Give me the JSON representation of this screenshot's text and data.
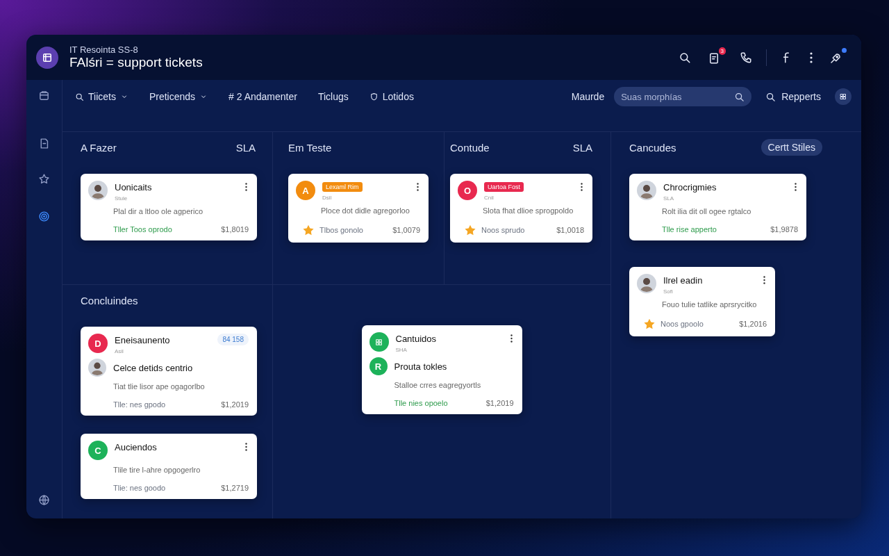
{
  "header": {
    "subtitle": "IT Resointa SS-8",
    "title": "FAlśri = support tickets",
    "notification_count": "3"
  },
  "sidebar": {
    "items": [
      {
        "selected": false
      },
      {
        "selected": false
      },
      {
        "selected": false
      },
      {
        "selected": true
      },
      {
        "selected": false
      }
    ]
  },
  "nav": {
    "tabs": [
      {
        "label": "Tiicets",
        "kind": "search",
        "dropdown": true
      },
      {
        "label": "Preticends",
        "kind": "plain",
        "dropdown": true
      },
      {
        "label": "# 2 Andamenter",
        "kind": "plain",
        "dropdown": false
      },
      {
        "label": "Ticlugs",
        "kind": "plain",
        "dropdown": false
      },
      {
        "label": "Lotidos",
        "kind": "shield",
        "dropdown": false
      }
    ],
    "filter_label": "Maurde",
    "search": {
      "placeholder": "Suas morphías"
    },
    "reports": "Repperts"
  },
  "lanes": [
    {
      "heading": "A Fazer",
      "aside": {
        "text": "SLA",
        "kind": "label"
      },
      "cards": [
        {
          "avatar": {
            "kind": "photo"
          },
          "title": "Uonicaits",
          "subtitle": "Stule",
          "desc": "Plal dir a ltloo ole agperico",
          "star": false,
          "footer": {
            "text": "Tller Toos oprodo",
            "kind": "success"
          },
          "amount": "$1,8019",
          "menu": true
        }
      ]
    },
    {
      "heading": "Em Teste",
      "cards": [
        {
          "avatar": {
            "kind": "letter",
            "letter": "A",
            "color": "#f28c0f"
          },
          "tag": {
            "text": "Lexaml Rim",
            "color": "#f28c0f"
          },
          "subtitle": "Dsil",
          "desc": "Ploce dot didle agregorloo",
          "star": true,
          "footer": {
            "text": "Tlbos gonolo",
            "kind": "muted"
          },
          "amount": "$1,0079",
          "menu": true
        }
      ]
    },
    {
      "heading": "Contude",
      "aside": {
        "text": "SLA",
        "kind": "label"
      },
      "cards": [
        {
          "avatar": {
            "kind": "letter",
            "letter": "O",
            "color": "#e8294f"
          },
          "tag": {
            "text": "Uartoa Fost",
            "color": "#e8294f"
          },
          "subtitle": "Cnil",
          "desc": "Slota fhat dlioe sprogpoldo",
          "star": true,
          "footer": {
            "text": "Noos sprudo",
            "kind": "muted"
          },
          "amount": "$1,0018",
          "menu": true
        }
      ]
    },
    {
      "heading": "Cancudes",
      "aside": {
        "text": "Certt Stiles",
        "kind": "pill"
      },
      "cards": [
        {
          "avatar": {
            "kind": "photo"
          },
          "title": "Chrocrigmies",
          "subtitle": "SLA",
          "desc": "Rolt ilia dit oll ogee rgtalco",
          "star": false,
          "footer": {
            "text": "Tlle rise apperto",
            "kind": "success"
          },
          "amount": "$1,9878",
          "menu": true
        },
        {
          "avatar": {
            "kind": "photo"
          },
          "title": "Ilrel eadin",
          "subtitle": "Sofi",
          "desc": "Fouo tulie tatlike aprsrycitko",
          "star": true,
          "footer": {
            "text": "Noos gpoolo",
            "kind": "muted"
          },
          "amount": "$1,2016",
          "menu": true
        }
      ]
    },
    {
      "heading": "Concluindes",
      "cards": [
        {
          "avatar": {
            "kind": "letter",
            "letter": "D",
            "color": "#e8294f"
          },
          "title": "Eneisaunento",
          "subtitle": "Asil",
          "count": "84 158",
          "extra": {
            "avatar": {
              "kind": "photo"
            },
            "title": "Celce detids centrio"
          },
          "desc": "Tiat tlie lisor ape ogagorlbo",
          "star": false,
          "footer": {
            "text": "Tlle: nes gpodo",
            "kind": "muted"
          },
          "amount": "$1,2019",
          "menu": false
        },
        {
          "avatar": {
            "kind": "letter",
            "letter": "C",
            "color": "#1db25a"
          },
          "title": "Auciendos",
          "desc": "Tlile tire l-ahre opgogerlro",
          "star": false,
          "footer": {
            "text": "Tlie: nes goodo",
            "kind": "muted"
          },
          "amount": "$1,2719",
          "menu": true
        }
      ]
    },
    {
      "cards": [
        {
          "avatar": {
            "kind": "icon",
            "color": "#1db25a"
          },
          "title": "Cantuidos",
          "subtitle": "SHA",
          "extra": {
            "avatar": {
              "kind": "letter",
              "letter": "R",
              "color": "#1db25a"
            },
            "title": "Prouta tokles"
          },
          "desc": "Stalloe crres eagregyortls",
          "star": false,
          "footer": {
            "text": "Tlle nies opoelo",
            "kind": "success"
          },
          "amount": "$1,2019",
          "menu": true
        }
      ]
    }
  ]
}
